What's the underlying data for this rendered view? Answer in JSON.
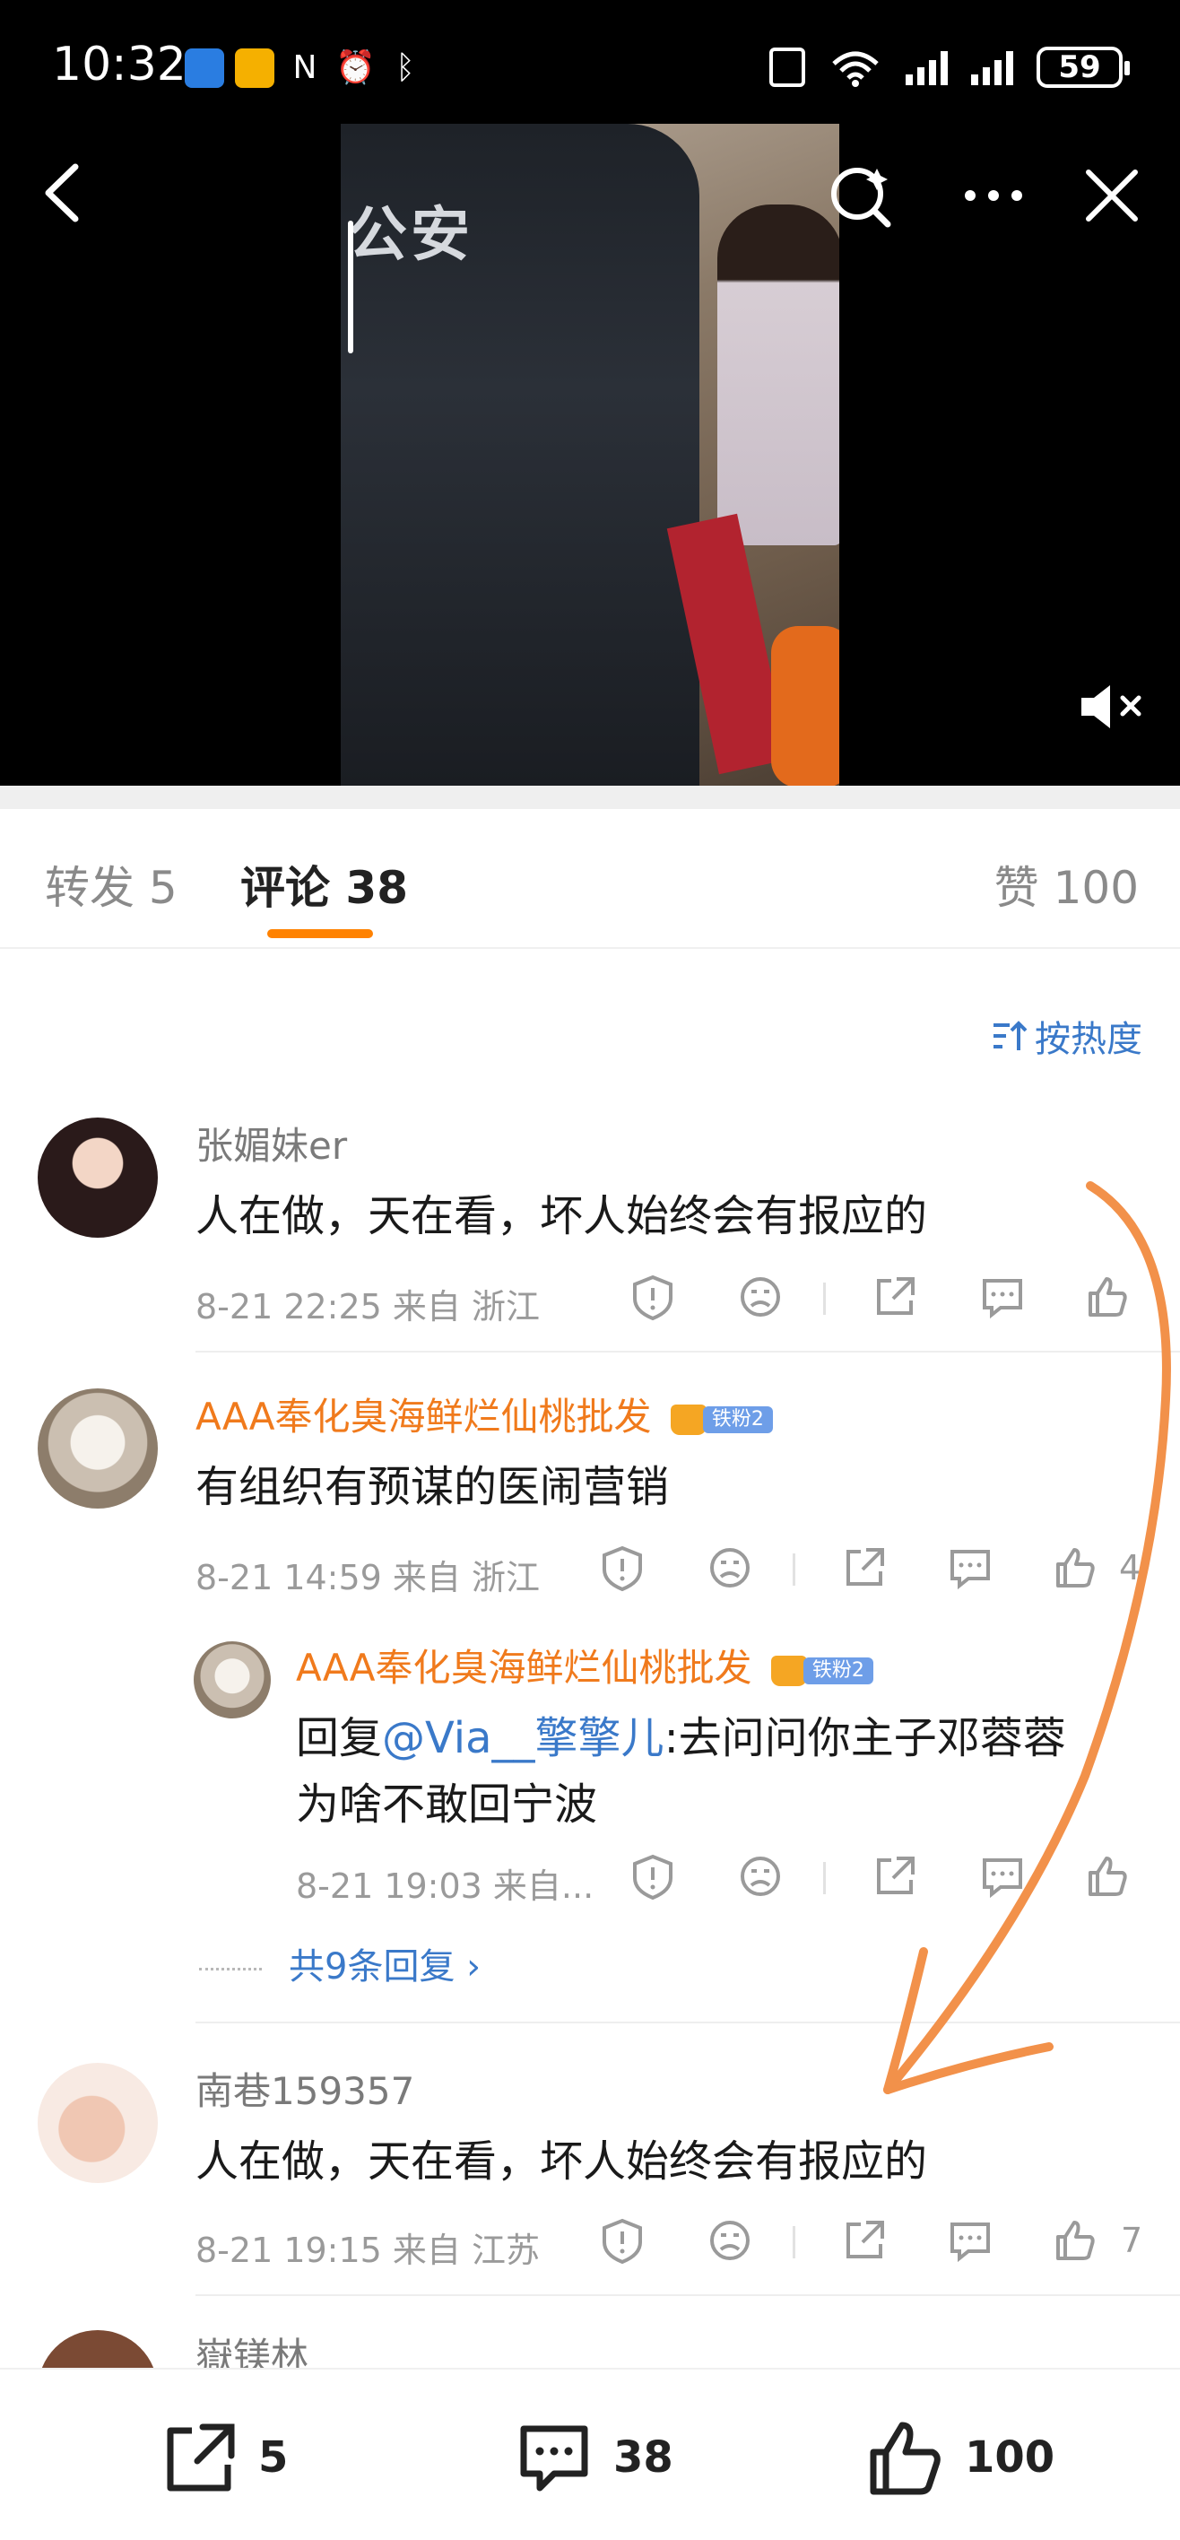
{
  "status_bar": {
    "time": "10:32",
    "battery": "59",
    "network": "6"
  },
  "video": {
    "vest_text": "公安",
    "muted": true
  },
  "tabs": {
    "repost": "转发 5",
    "comment": "评论 38",
    "like": "赞 100"
  },
  "sort_label": "按热度",
  "comments": [
    {
      "user": "张媚妹er",
      "text": "人在做，天在看，坏人始终会有报应的",
      "meta": "8-21 22:25  来自 浙江",
      "likes": ""
    },
    {
      "user": "AAA奉化臭海鲜烂仙桃批发",
      "badge": "铁粉2",
      "text": "有组织有预谋的医闹营销",
      "meta": "8-21 14:59  来自 浙江",
      "likes": "4",
      "reply": {
        "user": "AAA奉化臭海鲜烂仙桃批发",
        "badge": "铁粉2",
        "prefix": "回复",
        "mention": "@Via__擎擎儿",
        "text_line1": ":去问问你主子邓蓉蓉",
        "text_line2": "为啥不敢回宁波",
        "meta": "8-21 19:03  来自..."
      },
      "more_replies": "共9条回复 ›"
    },
    {
      "user": "南巷159357",
      "text": "人在做，天在看，坏人始终会有报应的",
      "meta": "8-21 19:15  来自 江苏",
      "likes": "7"
    },
    {
      "user": "嶽镁林"
    }
  ],
  "bottom_bar": {
    "reposts": "5",
    "comments": "38",
    "likes": "100"
  },
  "colors": {
    "accent": "#ff8200",
    "link": "#3a79c9",
    "vip_name": "#f07a1c",
    "annotation_arrow": "#f2914a"
  }
}
